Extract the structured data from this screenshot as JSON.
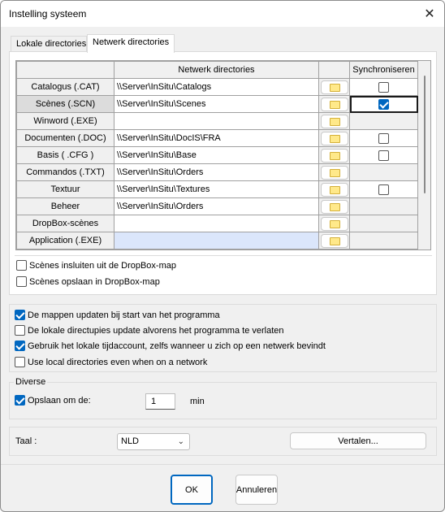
{
  "window": {
    "title": "Instelling systeem",
    "close_glyph": "✕"
  },
  "tabs": [
    {
      "label": "Lokale directories",
      "active": false
    },
    {
      "label": "Netwerk directories",
      "active": true
    }
  ],
  "grid": {
    "headers": {
      "name": "",
      "path": "Netwerk directories",
      "button": "",
      "sync": "Synchroniseren"
    },
    "rows": [
      {
        "name": "Catalogus (.CAT)",
        "path": "\\\\Server\\InSitu\\Catalogs",
        "sync": "unchecked"
      },
      {
        "name": "Scènes (.SCN)",
        "path": "\\\\Server\\InSitu\\Scenes",
        "sync": "checked"
      },
      {
        "name": "Winword (.EXE)",
        "path": "",
        "sync": "none"
      },
      {
        "name": "Documenten (.DOC)",
        "path": "\\\\Server\\InSitu\\DocIS\\FRA",
        "sync": "unchecked"
      },
      {
        "name": "Basis ( .CFG )",
        "path": "\\\\Server\\InSitu\\Base",
        "sync": "unchecked"
      },
      {
        "name": "Commandos (.TXT)",
        "path": "\\\\Server\\InSitu\\Orders",
        "sync": "none"
      },
      {
        "name": "Textuur",
        "path": "\\\\Server\\InSitu\\Textures",
        "sync": "unchecked"
      },
      {
        "name": "Beheer",
        "path": "\\\\Server\\InSitu\\Orders",
        "sync": "none"
      },
      {
        "name": "DropBox-scènes",
        "path": "",
        "sync": "none"
      },
      {
        "name": "Application (.EXE)",
        "path": "",
        "sync": "none"
      }
    ]
  },
  "dropbox": {
    "exclude_label": "Scènes insluiten uit de DropBox-map",
    "exclude_checked": false,
    "save_label": "Scènes opslaan in DropBox-map",
    "save_checked": false
  },
  "options": [
    {
      "label": "De mappen updaten bij start van het programma",
      "checked": true
    },
    {
      "label": "De lokale directupies update alvorens het programma te verlaten",
      "checked": false
    },
    {
      "label": "Gebruik het lokale tijdaccount, zelfs wanneer u zich op een netwerk bevindt",
      "checked": true
    },
    {
      "label": "Use local directories even when on a network",
      "checked": false
    }
  ],
  "diverse": {
    "legend": "Diverse",
    "autosave_label": "Opslaan om de:",
    "autosave_checked": true,
    "autosave_value": "1",
    "autosave_unit": "min"
  },
  "language": {
    "label": "Taal :",
    "selected": "NLD",
    "translate_button": "Vertalen..."
  },
  "footer": {
    "ok_label": "OK",
    "cancel_label": "Annuleren"
  },
  "colors": {
    "accent": "#0067c0",
    "selected_row": "#dbe6fb",
    "folder": "#ffe98a"
  }
}
